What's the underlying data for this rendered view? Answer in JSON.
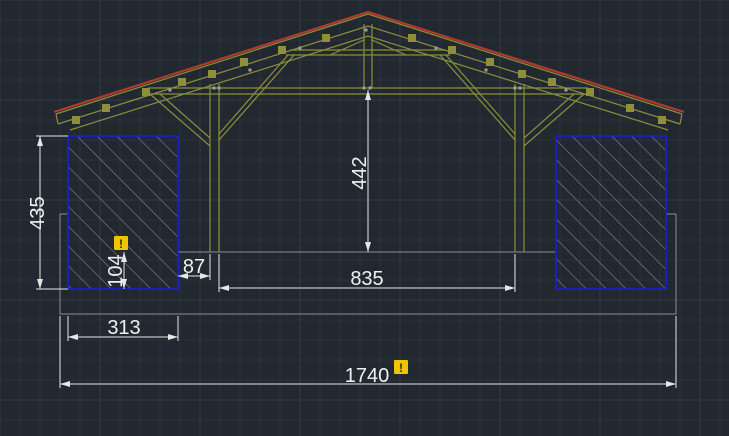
{
  "colors": {
    "background": "#212830",
    "grid_minor": "#2a323c",
    "grid_major": "#323b46",
    "dimension": "#e6e6e6",
    "outline": "#8a8f96",
    "timber": "#8d8f3a",
    "roof_edge": "#b03a2e",
    "hatch_border": "#1c1ce0",
    "hatch": "#7f8490",
    "warning": "#f0c400"
  },
  "dimensions": {
    "left_height": "435",
    "inner_height": "104",
    "gap": "87",
    "opening_width": "835",
    "post_height": "442",
    "block_width": "313",
    "total_width": "1740"
  },
  "icons": {
    "warning": "warning-icon",
    "warning_glyph": "!"
  }
}
